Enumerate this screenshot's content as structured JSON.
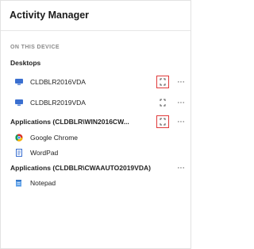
{
  "header": {
    "title": "Activity Manager"
  },
  "section": {
    "label": "ON THIS DEVICE"
  },
  "desktops": {
    "heading": "Desktops",
    "items": [
      {
        "label": "CLDBLR2016VDA",
        "icon": "desktop-icon",
        "highlighted": true
      },
      {
        "label": "CLDBLR2019VDA",
        "icon": "desktop-icon",
        "highlighted": false
      }
    ]
  },
  "app_groups": [
    {
      "heading": "Applications (CLDBLR\\WIN2016CW...",
      "highlighted": true,
      "items": [
        {
          "label": "Google Chrome",
          "icon": "chrome-icon"
        },
        {
          "label": "WordPad",
          "icon": "wordpad-icon"
        }
      ]
    },
    {
      "heading": "Applications (CLDBLR\\CWAAUTO2019VDA)",
      "items": [
        {
          "label": "Notepad",
          "icon": "notepad-icon"
        }
      ]
    }
  ],
  "more_label": "···",
  "colors": {
    "highlight": "#e03b3b",
    "desktop_icon": "#3a6fd0"
  }
}
